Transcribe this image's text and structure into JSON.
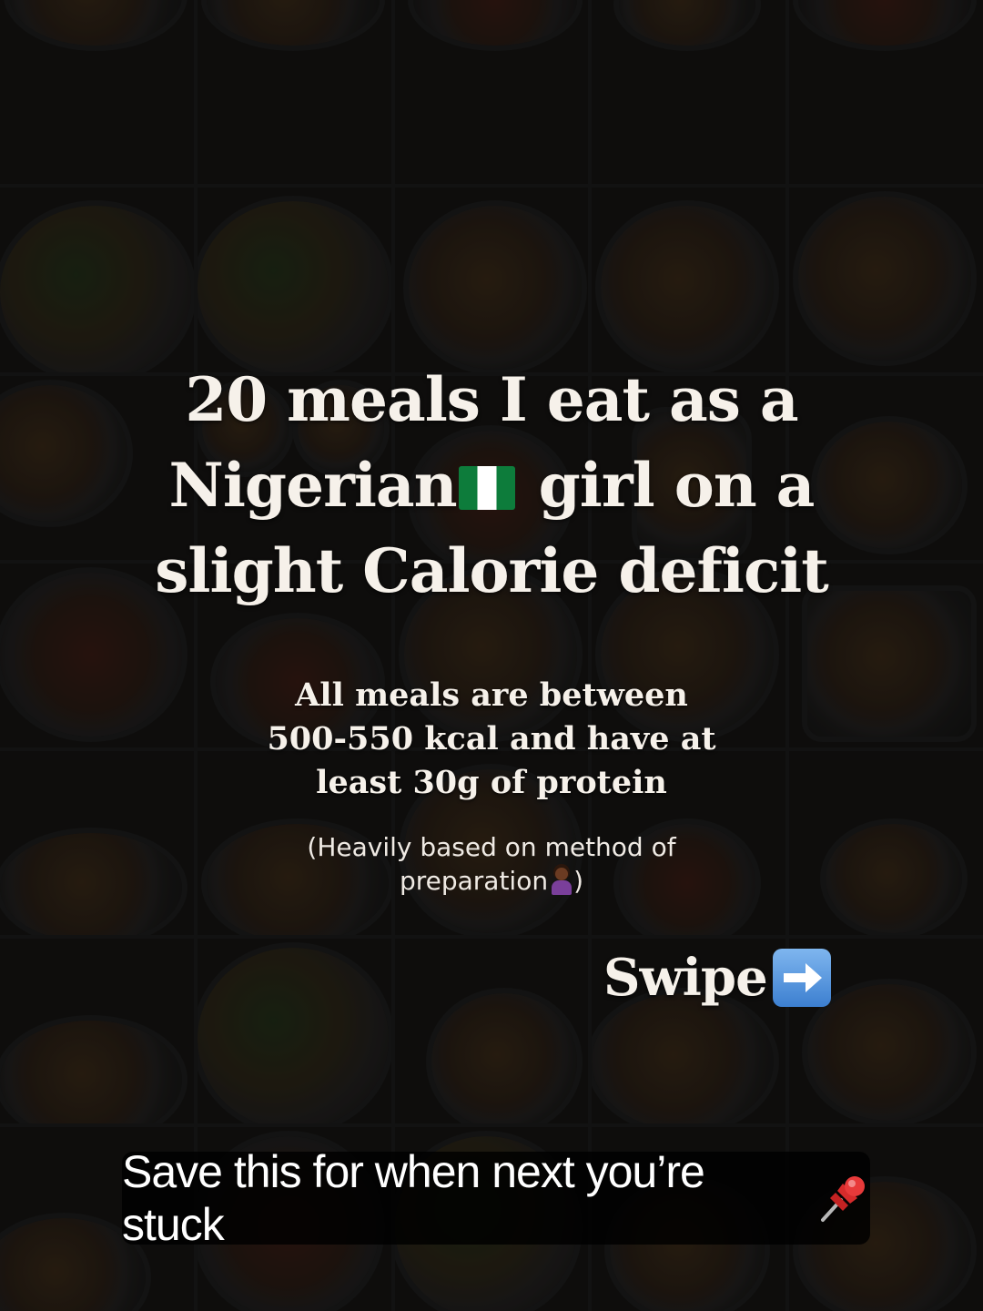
{
  "background": {
    "description_tiles": 35
  },
  "title": {
    "line1": "20 meals I eat as a",
    "line2_before_flag": "Nigerian",
    "flag_icon": "nigeria-flag-icon",
    "line2_after_flag": " girl on a",
    "line3": "slight Calorie deficit"
  },
  "subtitle": {
    "line1": "All meals are between",
    "line2": "500-550 kcal and have at",
    "line3": "least 30g of protein"
  },
  "note": {
    "line1": "(Heavily based on method of",
    "line2_before_icon": "preparation",
    "icon": "woman-shrugging-icon",
    "line2_after_icon": ")"
  },
  "swipe": {
    "label": "Swipe",
    "icon": "right-arrow-icon"
  },
  "save_caption": {
    "text": "Save this for when next you’re stuck",
    "icon": "pushpin-icon"
  },
  "colors": {
    "text": "#f6f1ea",
    "flag_green": "#0d7c3b",
    "arrow_blue": "#3c7fd0",
    "pin_red": "#d62b2b"
  }
}
